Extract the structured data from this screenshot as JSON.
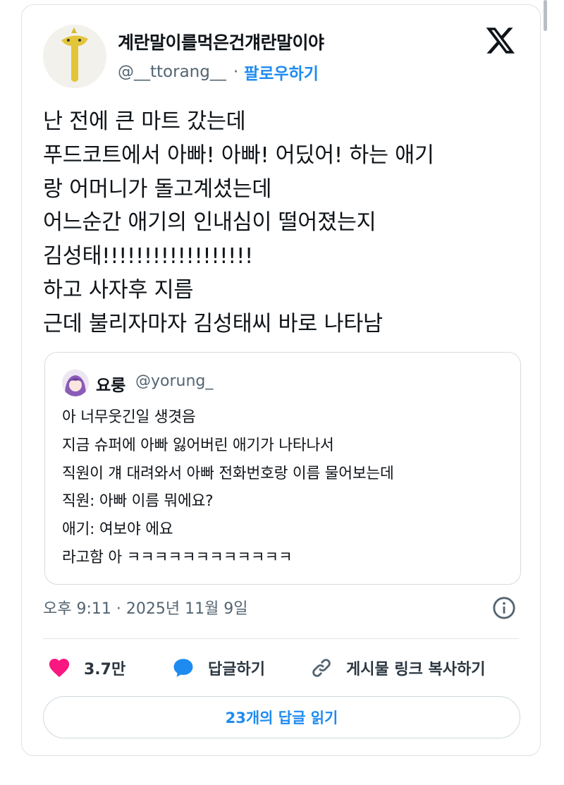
{
  "author": {
    "display_name": "계란말이를먹은건걔란말이야",
    "handle": "@__ttorang__",
    "separator": "·",
    "follow_label": "팔로우하기"
  },
  "tweet_lines": [
    "난 전에 큰 마트 갔는데",
    "푸드코트에서 아빠! 아빠! 어딨어! 하는 애기",
    "랑 어머니가 돌고계셨는데",
    "어느순간 애기의 인내심이 떨어졌는지",
    "김성태!!!!!!!!!!!!!!!!!!",
    "하고 사자후 지름",
    "근데 불리자마자 김성태씨 바로 나타남"
  ],
  "quote": {
    "name": "요룽",
    "handle": "@yorung_",
    "lines": [
      "아 너무웃긴일 생겻음",
      "지금 슈퍼에 아빠 잃어버린 애기가 나타나서",
      "직원이 걔 대려와서 아빠 전화번호랑 이름 물어보는데",
      "직원: 아빠 이름 뭐에요?",
      "애기: 여보야 에요",
      "라고함 아 ㅋㅋㅋㅋㅋㅋㅋㅋㅋㅋㅋㅋ"
    ]
  },
  "timestamp": "오후 9:11 · 2025년 11월 9일",
  "actions": {
    "likes": "3.7만",
    "reply_label": "답글하기",
    "copy_link_label": "게시물 링크 복사하기"
  },
  "read_replies_label": "23개의 답글 읽기",
  "icons": [
    "x-logo-icon",
    "info-icon",
    "heart-icon",
    "reply-bubble-icon",
    "link-icon"
  ],
  "colors": {
    "accent": "#1d8bf0",
    "like": "#f91880",
    "text": "#0f1419",
    "muted": "#536471"
  }
}
